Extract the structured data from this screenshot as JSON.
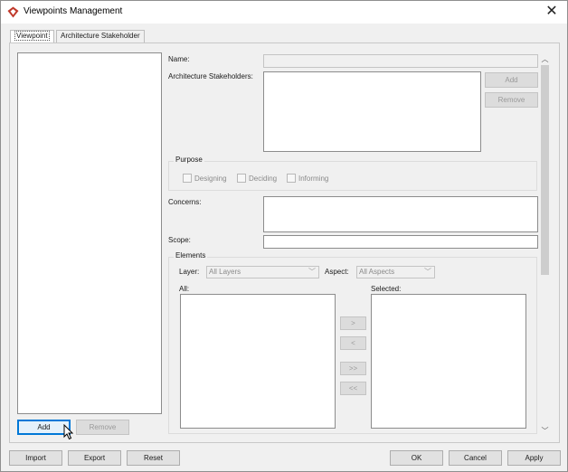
{
  "window": {
    "title": "Viewpoints Management",
    "close_glyph": "✕"
  },
  "tabs": [
    {
      "label": "Viewpoint",
      "active": true
    },
    {
      "label": "Architecture Stakeholder",
      "active": false
    }
  ],
  "viewpoint_list": {
    "add_label": "Add",
    "remove_label": "Remove"
  },
  "form": {
    "name_label": "Name:",
    "name_value": "",
    "stakeholders_label": "Architecture Stakeholders:",
    "stakeholder_add_label": "Add",
    "stakeholder_remove_label": "Remove",
    "purpose": {
      "title": "Purpose",
      "options": [
        "Designing",
        "Deciding",
        "Informing"
      ]
    },
    "concerns_label": "Concerns:",
    "scope_label": "Scope:",
    "elements": {
      "title": "Elements",
      "layer_label": "Layer:",
      "layer_value": "All Layers",
      "aspect_label": "Aspect:",
      "aspect_value": "All Aspects",
      "all_label": "All:",
      "selected_label": "Selected:",
      "move_right": ">",
      "move_left": "<",
      "move_all_right": ">>",
      "move_all_left": "<<"
    }
  },
  "footer": {
    "import_label": "Import",
    "export_label": "Export",
    "reset_label": "Reset",
    "ok_label": "OK",
    "cancel_label": "Cancel",
    "apply_label": "Apply"
  },
  "icons": {
    "app": "visual-paradigm-icon",
    "close": "close-icon",
    "scroll_up": "scroll-up-arrow-icon",
    "scroll_down": "scroll-down-arrow-icon",
    "combo_arrow": "chevron-down-icon",
    "cursor": "mouse-pointer-icon"
  },
  "colors": {
    "window_bg": "#f0f0f0",
    "focus_border": "#0078d7",
    "app_icon": "#c0392b"
  }
}
